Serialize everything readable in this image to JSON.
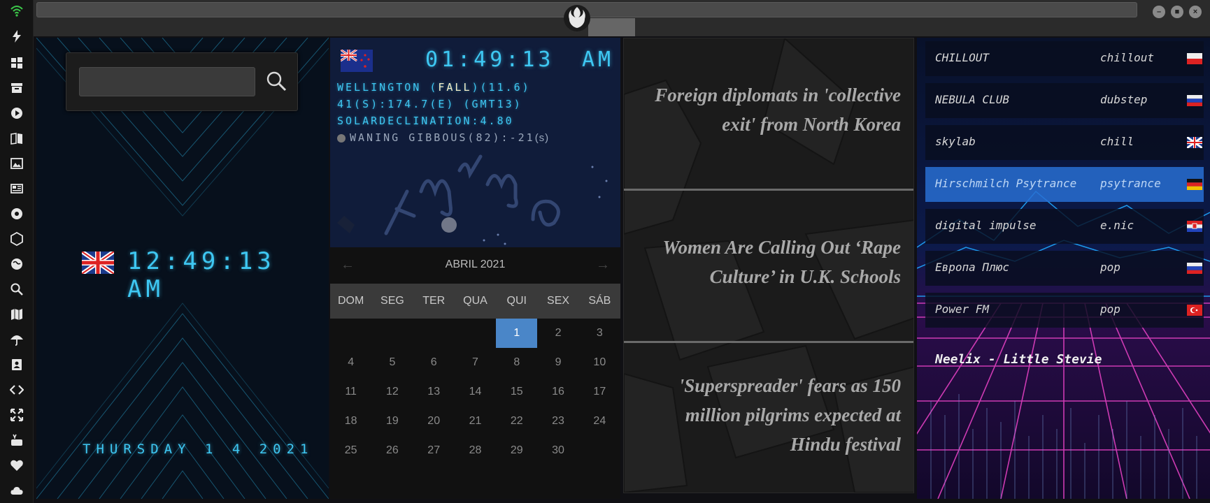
{
  "rail": {
    "icons": [
      "wifi-icon",
      "bolt-icon",
      "windows-icon",
      "archive-icon",
      "play-icon",
      "book-icon",
      "image-icon",
      "news-icon",
      "settings-icon",
      "hexagon-icon",
      "globe-icon",
      "search-icon",
      "map-icon",
      "umbrella-icon",
      "contacts-icon",
      "code-icon",
      "expand-icon",
      "youtube-icon",
      "heart-icon",
      "cloud-icon"
    ],
    "accent": "#3cc84a"
  },
  "window": {
    "minimize": "–",
    "maximize": "■",
    "close": "×"
  },
  "search": {
    "placeholder": "",
    "value": ""
  },
  "local_clock": {
    "time": "12:49:13 AM",
    "date": "THURSDAY 1 4 2021",
    "flag": "uk"
  },
  "world_clock": {
    "time": "01:49:13",
    "ampm": "AM",
    "flag": "nz",
    "line1_pre": "WELLINGTON (",
    "line1_season": "FALL",
    "line1_post": ")(11.6)",
    "line2": "41(S):174.7(E) (GMT13)",
    "line3": "SOLARDECLINATION:4.80",
    "line4": "WANING GIBBOUS(82):-21",
    "line4_suffix": "(s)"
  },
  "calendar": {
    "month": "ABRIL 2021",
    "prev": "←",
    "next": "→",
    "days": [
      "DOM",
      "SEG",
      "TER",
      "QUA",
      "QUI",
      "SEX",
      "SÁB"
    ],
    "weeks": [
      [
        "",
        "",
        "",
        "",
        "1",
        "2",
        "3"
      ],
      [
        "4",
        "5",
        "6",
        "7",
        "8",
        "9",
        "10"
      ],
      [
        "11",
        "12",
        "13",
        "14",
        "15",
        "16",
        "17"
      ],
      [
        "18",
        "19",
        "20",
        "21",
        "22",
        "23",
        "24"
      ],
      [
        "25",
        "26",
        "27",
        "28",
        "29",
        "30",
        ""
      ]
    ],
    "today": "1"
  },
  "news": {
    "items": [
      "Foreign diplomats in 'collective exit' from North Korea",
      "Women Are Calling Out ‘Rape Culture’ in U.K. Schools",
      "'Superspreader' fears as 150 million pilgrims expected at Hindu festival"
    ]
  },
  "radio": {
    "stations": [
      {
        "name": "CHILLOUT",
        "genre": "chillout",
        "flag": "pl"
      },
      {
        "name": "NEBULA CLUB",
        "genre": "dubstep",
        "flag": "ru"
      },
      {
        "name": "skylab",
        "genre": "chill",
        "flag": "uk"
      },
      {
        "name": "Hirschmilch Psytrance",
        "genre": "psytrance",
        "flag": "de"
      },
      {
        "name": "digital impulse",
        "genre": "e.nic",
        "flag": "hr"
      },
      {
        "name": "Европа Плюс",
        "genre": "pop",
        "flag": "ru"
      },
      {
        "name": "Power FM",
        "genre": "pop",
        "flag": "tr"
      }
    ],
    "active_index": 3,
    "now_playing": "Neelix - Little Stevie"
  },
  "colors": {
    "lcd": "#3ec7f2",
    "calendar_today": "#4a86c8",
    "radio_active": "#286ed2",
    "synth_pink": "#e040c0"
  }
}
